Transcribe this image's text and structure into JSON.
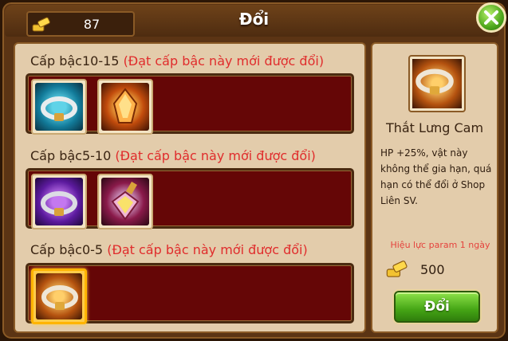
{
  "header": {
    "title": "Đổi",
    "currency_amount": "87",
    "currency_icon": "gold-bars-icon"
  },
  "tiers": [
    {
      "level_label": "Cấp bậc10-15",
      "requirement": "(Đạt cấp bậc này mới được đổi)",
      "items": [
        {
          "icon": "cyan-belt-icon"
        },
        {
          "icon": "fire-crystal-icon"
        }
      ]
    },
    {
      "level_label": "Cấp bậc5-10",
      "requirement": "(Đạt cấp bậc này mới được đổi)",
      "items": [
        {
          "icon": "purple-belt-icon"
        },
        {
          "icon": "potion-flask-icon"
        }
      ]
    },
    {
      "level_label": "Cấp bậc0-5",
      "requirement": "(Đạt cấp bậc này mới được đổi)",
      "items": [
        {
          "icon": "orange-belt-icon",
          "selected": true
        }
      ]
    }
  ],
  "detail": {
    "item_name": "Thắt Lưng Cam",
    "description": "HP +25%, vật này không thể gia hạn, quá hạn có thể đổi ở Shop Liên SV.",
    "validity": "Hiệu lực param 1 ngày",
    "price": "500",
    "exchange_label": "Đổi"
  },
  "colors": {
    "frame": "#5b3414",
    "panel": "#e3ccab",
    "slot_row": "#650606",
    "requirement_text": "#e02c2c",
    "button_green": "#45a515"
  }
}
